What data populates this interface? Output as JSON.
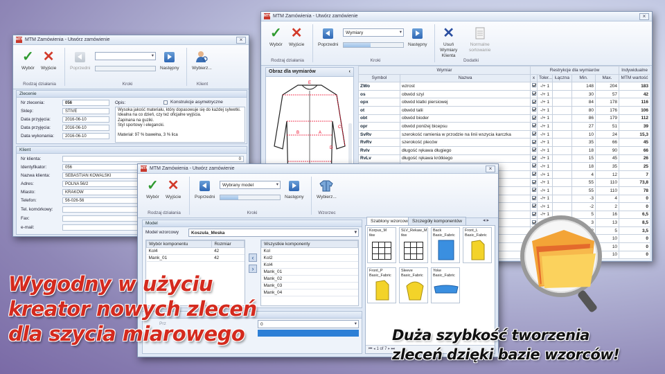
{
  "window_left": {
    "title": "MTM Zamówienia - Utwórz zamówienie",
    "ribbon": {
      "wybor": "Wybór",
      "wyjscie": "Wyjście",
      "group_actions": "Rodzaj działania",
      "poprzedni": "Poprzedni",
      "nastepny": "Następny",
      "group_steps": "Kroki",
      "wybierz": "Wybierz...",
      "group_client": "Klient"
    },
    "order": {
      "header": "Zlecenie",
      "nr_label": "Nr zlecenia:",
      "nr": "056",
      "sklep_label": "Sklep:",
      "sklep": "STIVE",
      "dp1_label": "Data przyjęcia:",
      "dp1": "2016-06-10",
      "dp2_label": "Data przyjęcia:",
      "dp2": "2016-06-10",
      "dw_label": "Data wykonania:",
      "dw": "2016-06-10",
      "opis_label": "Opis:",
      "asym": "Konstrukcje asymetryczne",
      "opis1": "Wysoka jakość materiału, który dopasowuje się do każdej sylwetki.",
      "opis2": "Idealna na co dzień, czy też oficjalne wyjścia.",
      "opis3": "Zapinana na guziki.",
      "opis4": "Styl sportowy i elegancki.",
      "opis5": "Materiał: 97 % bawełna, 3 % lica"
    },
    "client": {
      "header": "Klient",
      "nr_label": "Nr klienta:",
      "nr": "0",
      "id_label": "Identyfikator:",
      "id": "056",
      "name_label": "Nazwa klienta:",
      "name": "SEBASTIAN KOWALSKI",
      "addr_label": "Adres:",
      "addr": "POLNA 56/2",
      "city_label": "Miasto:",
      "city": "KRAKÓW",
      "phone_label": "Telefon:",
      "phone": "56-026-56",
      "mobile_label": "Tel. komórkowy:",
      "fax_label": "Fax:",
      "email_label": "e-mail:"
    }
  },
  "window_right": {
    "title": "MTM Zamówienia - Utwórz zamówienie",
    "ribbon": {
      "wybor": "Wybór",
      "wyjscie": "Wyjście",
      "group_actions": "Rodzaj działania",
      "combo": "Wymiary",
      "poprzedni": "Poprzedni",
      "nastepny": "Następny",
      "group_steps": "Kroki",
      "usun1": "Usuń",
      "usun2": "Wymiary",
      "usun3": "Klienta",
      "norm1": "Normalne",
      "norm2": "sortowanie",
      "group_extra": "Dodatki"
    },
    "panel_title": "Obraz dla wymiarów",
    "table": {
      "h_wymiar": "Wymiar",
      "h_restr": "Restrykcje dla wymiarów",
      "h_indiv": "Indywidualne",
      "h_symbol": "Symbol",
      "h_nazwa": "Nazwa",
      "h_x": "x",
      "h_tol": "Toler...",
      "h_laczna": "Łączna",
      "h_min": "Min.",
      "h_max": "Max.",
      "h_mtm": "MTM wartość",
      "rows": [
        [
          "ZWo",
          "wzrost",
          "-/+ 1",
          "148",
          "204",
          "183"
        ],
        [
          "os",
          "obwód szyi",
          "-/+ 1",
          "30",
          "57",
          "42"
        ],
        [
          "opx",
          "obwód klatki piersiowej",
          "-/+ 1",
          "84",
          "178",
          "116"
        ],
        [
          "ot",
          "obwód talii",
          "-/+ 1",
          "80",
          "176",
          "106"
        ],
        [
          "obt",
          "obwód bioder",
          "-/+ 1",
          "86",
          "179",
          "112"
        ],
        [
          "opr",
          "obwód poniżej bicepsu",
          "-/+ 1",
          "27",
          "51",
          "39"
        ],
        [
          "SvRv",
          "szerokość ramienia w przodzie na linii wszycia karczka",
          "-/+ 1",
          "10",
          "24",
          "15,3"
        ],
        [
          "RvRv",
          "szerokość pleców",
          "-/+ 1",
          "35",
          "66",
          "45"
        ],
        [
          "Rvlv",
          "długość rękawa długiego",
          "-/+ 1",
          "18",
          "90",
          "66"
        ],
        [
          "RvLv",
          "długość rękawa krótkiego",
          "-/+ 1",
          "15",
          "45",
          "26"
        ],
        [
          "dm",
          "długość mankietu",
          "-/+ 1",
          "18",
          "35",
          "25"
        ],
        [
          "",
          "",
          "-/+ 1",
          "4",
          "12",
          "7"
        ],
        [
          "",
          "",
          "-/+ 1",
          "55",
          "110",
          "73,8"
        ],
        [
          "",
          "",
          "-/+ 1",
          "55",
          "110",
          "78"
        ],
        [
          "",
          "",
          "-/+ 1",
          "-3",
          "4",
          "0"
        ],
        [
          "",
          "",
          "-/+ 1",
          "-2",
          "2",
          "0"
        ],
        [
          "",
          "",
          "-/+ 1",
          "5",
          "16",
          "6,5"
        ],
        [
          "",
          "",
          "-/+ 1",
          "3",
          "13",
          "8,5"
        ],
        [
          "",
          "",
          "-/+ 1",
          "2",
          "5",
          "3,5"
        ],
        [
          "",
          "",
          "",
          "",
          "10",
          "0"
        ],
        [
          "",
          "",
          "",
          "",
          "10",
          "0"
        ],
        [
          "",
          "",
          "",
          "",
          "10",
          "0"
        ]
      ]
    }
  },
  "window_mid": {
    "title": "MTM Zamówienia - Utwórz zamówienie",
    "ribbon": {
      "wybor": "Wybór",
      "wyjscie": "Wyjście",
      "group_actions": "Rodzaj działania",
      "poprzedni": "Poprzedni",
      "combo": "Wybrany model",
      "nastepny": "Następny",
      "group_steps": "Kroki",
      "wybierz": "Wybierz...",
      "group_pattern": "Wzorzec"
    },
    "model": {
      "header": "Model",
      "label": "Model wzorcowy",
      "value": "Koszula_Meska",
      "col1": "Wybór komponentu",
      "col2": "Rozmiar",
      "selected": [
        [
          "Kol4",
          "42"
        ],
        [
          "Mank_01",
          "42"
        ]
      ],
      "all_header": "Wszystkie komponenty",
      "all": [
        "Kol",
        "Kol2",
        "Kol4",
        "Mank_01",
        "Mank_02",
        "Mank_03",
        "Mank_04"
      ]
    },
    "tabs": {
      "t1": "Szablony wzorcowe",
      "t2": "Szczegóły komponentów"
    },
    "pieces": [
      {
        "n": "Korpus_M",
        "m": "tkw"
      },
      {
        "n": "SLV_Rekaw_M",
        "m": "tkw"
      },
      {
        "n": "Back",
        "m": "Basic_Fabric"
      },
      {
        "n": "Front_L",
        "m": "Basic_Fabric"
      },
      {
        "n": "Front_P",
        "m": "Basic_Fabric"
      },
      {
        "n": "Sleeve",
        "m": "Basic_Fabric"
      },
      {
        "n": "Yoke",
        "m": "Basic_Fabric"
      }
    ],
    "pager": "1 of 7",
    "lower_label": "Prz",
    "lower_value": "0"
  },
  "slogan_left": [
    "Wygodny w użyciu",
    "kreator nowych zleceń",
    "dla szycia miarowego"
  ],
  "slogan_right": [
    "Duża szybkość tworzenia",
    "zleceń dzięki bazie wzorców!"
  ],
  "colors": {
    "slogan_left": "#d42a1e",
    "slogan_right": "#111111"
  }
}
